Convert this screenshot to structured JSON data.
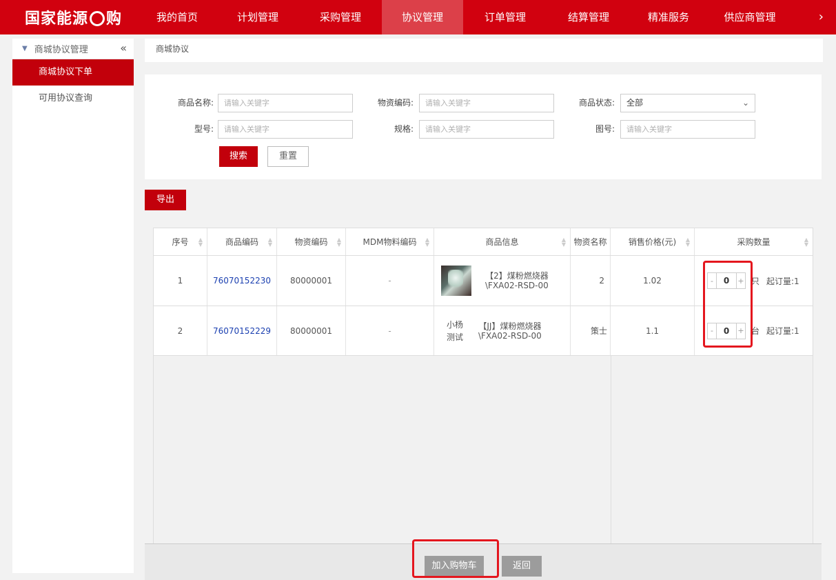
{
  "brand": {
    "logo_text_left": "国家能源",
    "logo_text_right": "购"
  },
  "nav": {
    "items": [
      "我的首页",
      "计划管理",
      "采购管理",
      "协议管理",
      "订单管理",
      "结算管理",
      "精准服务",
      "供应商管理"
    ],
    "active": "协议管理",
    "more_icon": "chevron-right-icon"
  },
  "sidebar": {
    "group_label": "商城协议管理",
    "collapse_icon": "double-chevron-left-icon",
    "items": [
      {
        "label": "商城协议下单",
        "active": true
      },
      {
        "label": "可用协议查询",
        "active": false
      }
    ]
  },
  "breadcrumb": "商城协议",
  "filters": {
    "goods_name_label": "商品名称:",
    "goods_name_placeholder": "请输入关键字",
    "material_code_label": "物资编码:",
    "material_code_placeholder": "请输入关键字",
    "status_label": "商品状态:",
    "status_value": "全部",
    "model_label": "型号:",
    "model_placeholder": "请输入关键字",
    "spec_label": "规格:",
    "spec_placeholder": "请输入关键字",
    "drawing_label": "图号:",
    "drawing_placeholder": "请输入关键字",
    "search_label": "搜索",
    "reset_label": "重置"
  },
  "export_label": "导出",
  "table": {
    "headers": [
      "序号",
      "商品编码",
      "物资编码",
      "MDM物料编码",
      "商品信息",
      "物资名称",
      "销售价格(元)",
      "采购数量"
    ],
    "rows": [
      {
        "index": "1",
        "goods_code": "76070152230",
        "material_code": "80000001",
        "mdm_code": "-",
        "info_line1": "【2】煤粉燃烧器",
        "info_line2": "\\FXA02-RSD-00",
        "material_name": "2",
        "price": "1.02",
        "qty": "0",
        "unit": "只",
        "min_order": "起订量:1"
      },
      {
        "index": "2",
        "goods_code": "76070152229",
        "material_code": "80000001",
        "mdm_code": "-",
        "info_side1": "小杨",
        "info_side2": "测试",
        "info_line1": "【JJ】煤粉燃烧器",
        "info_line2": "\\FXA02-RSD-00",
        "material_name": "策士",
        "price": "1.1",
        "qty": "0",
        "unit": "台",
        "min_order": "起订量:1"
      }
    ]
  },
  "footer": {
    "add_to_cart": "加入购物车",
    "back": "返回"
  },
  "colors": {
    "brand_red": "#d1010f",
    "active_nav": "#dc4049",
    "button_red": "#c2000b",
    "link_blue": "#1a3fb0",
    "highlight_box": "#e4161e"
  }
}
